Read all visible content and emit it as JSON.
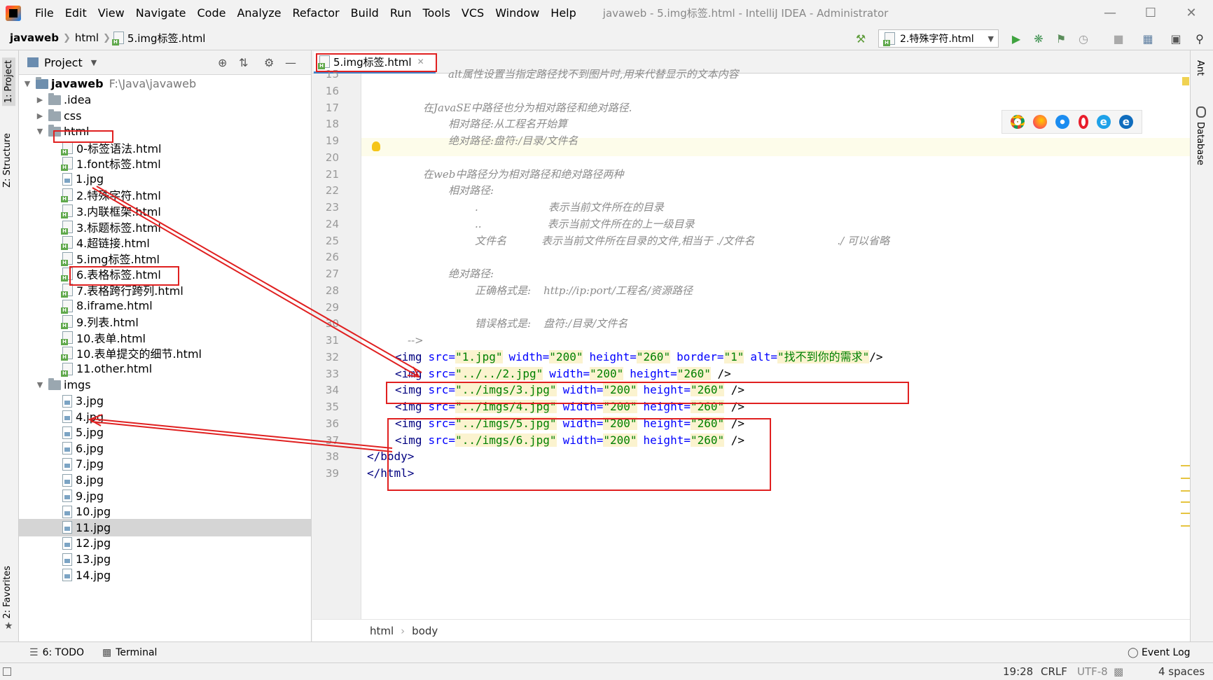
{
  "window": {
    "title": "javaweb - 5.img标签.html - IntelliJ IDEA - Administrator",
    "minimize_icon": "minimize-icon",
    "maximize_icon": "maximize-icon",
    "close_icon": "close-icon"
  },
  "menu": [
    "File",
    "Edit",
    "View",
    "Navigate",
    "Code",
    "Analyze",
    "Refactor",
    "Build",
    "Run",
    "Tools",
    "VCS",
    "Window",
    "Help"
  ],
  "breadcrumbs": [
    "javaweb",
    "html",
    "5.img标签.html"
  ],
  "toolbar": {
    "run_config": "2.特殊字符.html",
    "icons": [
      "hammer-icon",
      "run-icon",
      "debug-icon",
      "coverage-icon",
      "profile-icon",
      "stop-icon",
      "project-structure-icon",
      "layout-icon",
      "search-icon"
    ]
  },
  "left_stripe": {
    "project_tab": "1: Project",
    "structure_tab": "Z: Structure",
    "favorites_tab": "2: Favorites"
  },
  "project_panel": {
    "title": "Project",
    "root": {
      "name": "javaweb",
      "path": "F:\\Java\\javaweb"
    },
    "folders": [
      ".idea",
      "css",
      "html",
      "imgs"
    ],
    "html_files": [
      "0-标签语法.html",
      "1.font标签.html",
      "1.jpg",
      "2.特殊字符.html",
      "3.内联框架.html",
      "3.标题标签.html",
      "4.超链接.html",
      "5.img标签.html",
      "6.表格标签.html",
      "7.表格跨行跨列.html",
      "8.iframe.html",
      "9.列表.html",
      "10.表单.html",
      "10.表单提交的细节.html",
      "11.other.html"
    ],
    "img_files": [
      "3.jpg",
      "4.jpg",
      "5.jpg",
      "6.jpg",
      "7.jpg",
      "8.jpg",
      "9.jpg",
      "10.jpg",
      "11.jpg",
      "12.jpg",
      "13.jpg",
      "14.jpg"
    ],
    "selected_file": "11.jpg"
  },
  "editor": {
    "tab": "5.img标签.html",
    "line_numbers": [
      "15",
      "16",
      "17",
      "18",
      "19",
      "20",
      "21",
      "22",
      "23",
      "24",
      "25",
      "26",
      "27",
      "28",
      "29",
      "30",
      "31",
      "32",
      "33",
      "34",
      "35",
      "36",
      "37",
      "38",
      "39"
    ],
    "comments": {
      "l15": "alt属性设置当指定路径找不到图片时,用来代替显示的文本内容",
      "l17": "在JavaSE中路径也分为相对路径和绝对路径.",
      "l18": "相对路径:从工程名开始算",
      "l19": "绝对路径:盘符:/目录/文件名",
      "l21": "在web中路径分为相对路径和绝对路径两种",
      "l22": "相对路径:",
      "l23a": ".",
      "l23b": "表示当前文件所在的目录",
      "l24a": "..",
      "l24b": "表示当前文件所在的上一级目录",
      "l25a": "文件名",
      "l25b": "表示当前文件所在目录的文件,相当于 ./文件名",
      "l25c": "./ 可以省略",
      "l27": "绝对路径:",
      "l28a": "正确格式是:",
      "l28b": "http://ip:port/",
      "l28c": "工程名/资源路径",
      "l30a": "错误格式是:",
      "l30b": "盘符:/目录/文件名",
      "l31": "-->"
    },
    "code": {
      "l32": {
        "src": "\"1.jpg\"",
        "width": "\"200\"",
        "height": "\"260\"",
        "border": "\"1\"",
        "alt": "\"找不到你的需求\""
      },
      "l33": {
        "src": "\"../../2.jpg\"",
        "width": "\"200\"",
        "height": "\"260\""
      },
      "l34": {
        "src": "\"../imgs/3.jpg\"",
        "width": "\"200\"",
        "height": "\"260\""
      },
      "l35": {
        "src": "\"../imgs/4.jpg\"",
        "width": "\"200\"",
        "height": "\"260\""
      },
      "l36": {
        "src": "\"../imgs/5.jpg\"",
        "width": "\"200\"",
        "height": "\"260\""
      },
      "l37": {
        "src": "\"../imgs/6.jpg\"",
        "width": "\"200\"",
        "height": "\"260\""
      },
      "l38": "</body>",
      "l39": "</html>"
    },
    "tokens": {
      "img": "<img",
      "src": "src=",
      "width": "width=",
      "height": "height=",
      "border": "border=",
      "alt": "alt=",
      "close": "/>",
      "close_sp": " />"
    },
    "breadcrumb": [
      "html",
      "body"
    ]
  },
  "right_stripe": {
    "ant": "Ant",
    "database": "Database"
  },
  "browsers": [
    "chrome-icon",
    "firefox-icon",
    "safari-icon",
    "opera-icon",
    "ie-icon",
    "edge-icon"
  ],
  "bottom_tools": {
    "todo": "6: TODO",
    "terminal": "Terminal",
    "event_log": "Event Log"
  },
  "status": {
    "position": "19:28",
    "line_ending": "CRLF",
    "encoding": "UTF-8",
    "indent": "4 spaces"
  },
  "colors": {
    "annotation": "#e02020",
    "tag": "#000080",
    "attr": "#0000ff",
    "value": "#008000",
    "comment": "#8c8c8c"
  }
}
